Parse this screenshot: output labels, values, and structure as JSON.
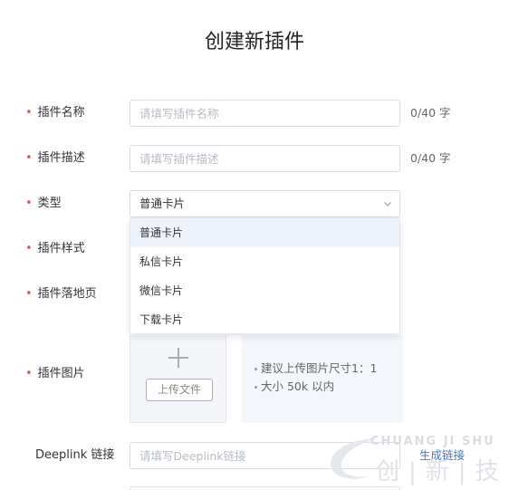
{
  "page": {
    "title": "创建新插件"
  },
  "form": {
    "name": {
      "label": "插件名称",
      "placeholder": "请填写插件名称",
      "counter": "0/40 字"
    },
    "desc": {
      "label": "插件描述",
      "placeholder": "请填写插件描述",
      "counter": "0/40 字"
    },
    "type": {
      "label": "类型",
      "selected": "普通卡片",
      "options": [
        "普通卡片",
        "私信卡片",
        "微信卡片",
        "下载卡片"
      ]
    },
    "style": {
      "label": "插件样式"
    },
    "landing": {
      "label": "插件落地页"
    },
    "image": {
      "label": "插件图片",
      "upload_label": "上传文件",
      "tips": [
        "建议上传图片尺寸1：1",
        "大小 50k 以内"
      ]
    },
    "deeplink": {
      "label": "Deeplink 链接",
      "placeholder": "请填写Deeplink链接",
      "action": "生成链接"
    }
  },
  "watermark": {
    "top": "CHUANG JI SHU",
    "bottom": "创|新|技"
  },
  "colors": {
    "required": "#e45b55",
    "link": "#3b78d8",
    "hover": "#eef3fb"
  }
}
